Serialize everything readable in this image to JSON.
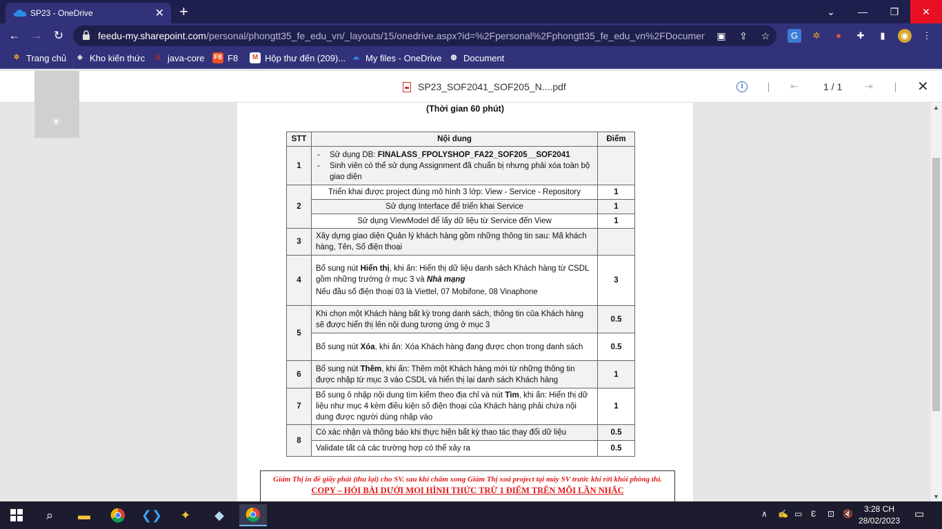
{
  "browser": {
    "tab_title": "SP23 - OneDrive",
    "tab_close": "✕",
    "new_tab": "+",
    "minimize": "⌄",
    "restore": "—",
    "maximize": "❐",
    "close": "✕",
    "url_host": "feedu-my.sharepoint.com",
    "url_path": "/personal/phongtt35_fe_edu_vn/_layouts/15/onedrive.aspx?id=%2Fpersonal%2Fphongtt35_fe_edu_vn%2FDocument..."
  },
  "bookmarks": [
    {
      "label": "Trang chủ",
      "icon": "fpt-icon"
    },
    {
      "label": "Kho kiến thức",
      "icon": "book-icon"
    },
    {
      "label": "java-core",
      "icon": "java-icon"
    },
    {
      "label": "F8",
      "icon": "f8-icon"
    },
    {
      "label": "Hộp thư đến (209)...",
      "icon": "gmail-icon"
    },
    {
      "label": "My files - OneDrive",
      "icon": "onedrive-icon"
    },
    {
      "label": "Document",
      "icon": "globe-icon"
    }
  ],
  "pdf_viewer": {
    "filename": "SP23_SOF2041_SOF205_N....pdf",
    "info": "i",
    "page_indicator": "1 / 1",
    "close": "✕"
  },
  "document": {
    "time": "(Thời gian 60 phút)",
    "headers": {
      "stt": "STT",
      "content": "Nội dung",
      "score": "Điểm"
    },
    "rows": {
      "r1_stt": "1",
      "r1_line1_prefix": "Sử dụng DB: ",
      "r1_line1_bold": "FINALASS_FPOLYSHOP_FA22_SOF205__SOF2041",
      "r1_line2": "Sinh viên có thể sử dụng Assignment đã chuẩn bị nhưng phải xóa toàn bộ giao diện",
      "r2_stt": "2",
      "r2a": "Triển khai được project đúng mô hình 3 lớp: View - Service - Repository",
      "r2a_score": "1",
      "r2b": "Sử dụng Interface để triển khai Service",
      "r2b_score": "1",
      "r2c": "Sử dụng ViewModel để lấy dữ liệu từ Service đến View",
      "r2c_score": "1",
      "r3_stt": "3",
      "r3": "Xây dựng giao diện Quản lý khách hàng gồm những thông tin sau: Mã khách hàng, Tên, Số điện thoại",
      "r4_stt": "4",
      "r4_pre": "Bổ sung nút ",
      "r4_bold": "Hiển thị",
      "r4_mid": ", khi ấn: Hiển thị dữ liệu danh sách Khách hàng từ CSDL gồm những trường ở mục 3 và ",
      "r4_bolditalic": "Nhà mạng",
      "r4_line2": "Nếu đầu số điện thoại 03 là Viettel, 07 Mobifone, 08 Vinaphone",
      "r4_score": "3",
      "r5_stt": "5",
      "r5a": "Khi chọn một Khách hàng bất kỳ trong danh sách, thông tin của Khách hàng sẽ được hiển thị lên nội dung tương ứng ở mục 3",
      "r5a_score": "0.5",
      "r5b_pre": "Bổ sung nút ",
      "r5b_bold": "Xóa",
      "r5b_post": ", khi ấn: Xóa Khách hàng đang được chọn trong danh sách",
      "r5b_score": "0.5",
      "r6_stt": "6",
      "r6_pre": "Bổ sung nút ",
      "r6_bold": "Thêm",
      "r6_post": ", khi ấn: Thêm một Khách hàng mới từ những thông tin được nhập từ mục 3 vào CSDL và hiển thị lại danh sách Khách hàng",
      "r6_score": "1",
      "r7_stt": "7",
      "r7_pre": "Bổ sung ô nhập nội dung tìm kiếm theo địa chỉ và nút ",
      "r7_bold": "Tìm",
      "r7_post": ", khi ấn: Hiển thị dữ liệu như mục 4 kèm điều kiện số điện thoại của Khách hàng phải chứa nội dung được người dùng nhập vào",
      "r7_score": "1",
      "r8_stt": "8",
      "r8a": "Có xác nhận và thông báo khi thực hiện bất kỳ thao tác thay đổi dữ liệu",
      "r8a_score": "0.5",
      "r8b": "Validate tất cả các trường hợp có thể xảy ra",
      "r8b_score": "0.5"
    },
    "notice_line1": "Giám Thị in đề giấy phát (thu lại) cho SV. sau khi chấm xong Giám Thị xoá project tại máy SV trước khi rời khỏi phòng thi.",
    "notice_line2": "COPY – HỎI BÀI DƯỚI MỌI HÌNH THỨC TRỪ 1 ĐIỂM TRÊN MỖI LẦN NHẮC"
  },
  "taskbar": {
    "time": "3:28 CH",
    "date": "28/02/2023"
  },
  "colors": {
    "browser_frame": "#1f1f4e",
    "toolbar": "#32327a",
    "notice_red": "#e21a1a",
    "close_red": "#e81123"
  }
}
